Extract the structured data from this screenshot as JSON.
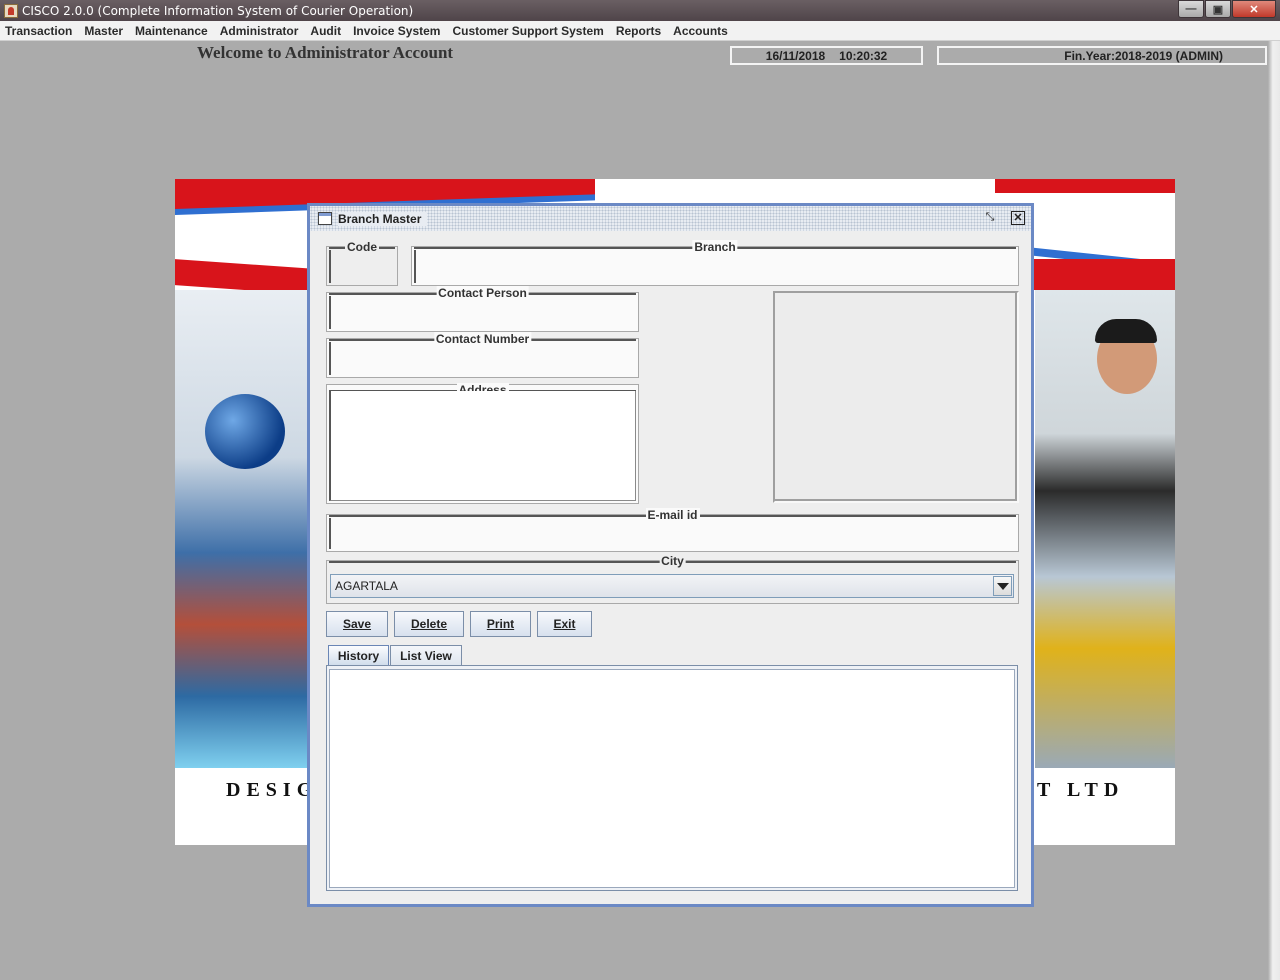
{
  "window": {
    "title": "CISCO 2.0.0 (Complete Information System of Courier Operation)",
    "buttons": {
      "minimize": "—",
      "maximize": "▣",
      "close": "✕"
    }
  },
  "menubar": [
    "Transaction",
    "Master",
    "Maintenance",
    "Administrator",
    "Audit",
    "Invoice System",
    "Customer Support System",
    "Reports",
    "Accounts"
  ],
  "header": {
    "welcome": "Welcome to Administrator Account",
    "date": "16/11/2018",
    "time": "10:20:32",
    "fin_year": "Fin.Year:2018-2019  (ADMIN)"
  },
  "banner": {
    "text_left": "DESIG",
    "text_right": "T LTD"
  },
  "branch_master": {
    "title": "Branch Master",
    "fields": {
      "code": {
        "label": "Code",
        "value": ""
      },
      "branch": {
        "label": "Branch",
        "value": ""
      },
      "contact_person": {
        "label": "Contact Person",
        "value": ""
      },
      "contact_number": {
        "label": "Contact Number",
        "value": ""
      },
      "address": {
        "label": "Address",
        "value": ""
      },
      "email": {
        "label": "E-mail id",
        "value": ""
      },
      "city": {
        "label": "City",
        "value": "AGARTALA"
      }
    },
    "buttons": {
      "save": "Save",
      "delete": "Delete",
      "print": "Print",
      "exit": "Exit"
    },
    "tabs": [
      "History",
      "List View"
    ],
    "active_tab": "History"
  },
  "colors": {
    "desktop_bg": "#ababab",
    "frame_border": "#6b89c5",
    "banner_red": "#d8141b",
    "banner_blue": "#2f6fd1"
  },
  "icons": {
    "app": "cisco-app-icon",
    "frame": "internal-frame-icon",
    "restore": "restore-icon",
    "close": "close-icon",
    "dropdown": "chevron-down-icon"
  }
}
